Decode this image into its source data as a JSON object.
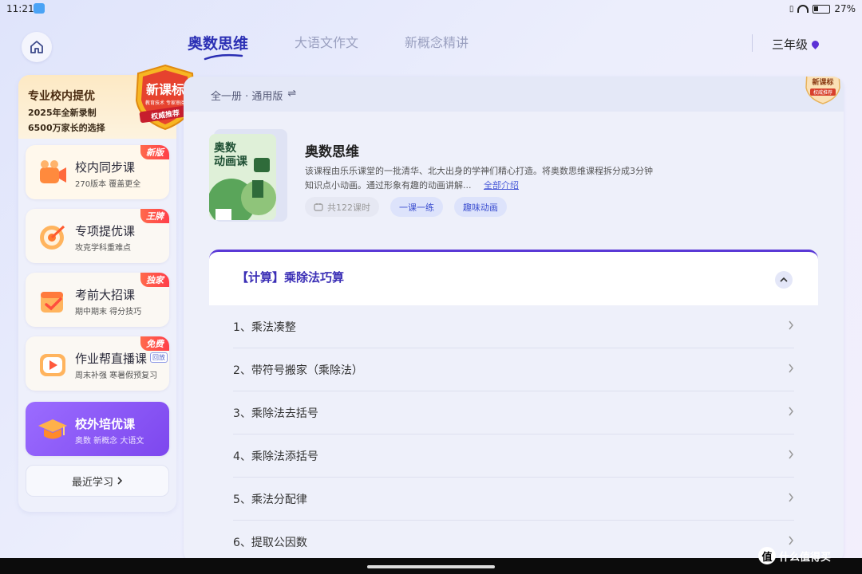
{
  "status": {
    "time": "11:21",
    "battery": "27%"
  },
  "nav": {
    "tabs": [
      {
        "label": "奥数思维",
        "active": true
      },
      {
        "label": "大语文作文",
        "active": false
      },
      {
        "label": "新概念精讲",
        "active": false
      }
    ],
    "grade": "三年级"
  },
  "sidebar": {
    "promo": {
      "headline": "专业校内提优",
      "line1": "2025年全新录制",
      "line2": "6500万家长的选择",
      "badge": "新课标",
      "badge_sub": "教育技术 专家审阅",
      "badge_ribbon": "权威推荐"
    },
    "items": [
      {
        "title": "校内同步课",
        "desc": "270版本 覆盖更全",
        "tag": "新版",
        "icon": "video-camera-icon"
      },
      {
        "title": "专项提优课",
        "desc": "攻克学科重难点",
        "tag": "王牌",
        "icon": "target-icon"
      },
      {
        "title": "考前大招课",
        "desc": "期中期末 得分技巧",
        "tag": "独家",
        "icon": "calendar-check-icon"
      },
      {
        "title": "作业帮直播课",
        "desc": "周末补强 寒暑假预复习",
        "tag": "免费",
        "mini": "回放",
        "icon": "play-icon"
      },
      {
        "title": "校外培优课",
        "desc": "奥数 新概念 大语文",
        "icon": "graduation-cap-icon",
        "active": true
      }
    ],
    "recent": "最近学习"
  },
  "panel": {
    "volume": "全一册 · 通用版",
    "badge": "新课标",
    "badge_ribbon": "权威推荐",
    "course": {
      "cover_text": "奥数\n动画课",
      "title": "奥数思维",
      "desc": "该课程由乐乐课堂的一批清华、北大出身的学神们精心打造。将奥数思维课程拆分成3分钟知识点小动画。通过形象有趣的动画讲解...",
      "more": "全部介绍",
      "pills": [
        "共122课时",
        "一课一练",
        "趣味动画"
      ]
    },
    "chapter": "【计算】乘除法巧算",
    "lessons": [
      "1、乘法凑整",
      "2、带符号搬家（乘除法）",
      "3、乘除法去括号",
      "4、乘除法添括号",
      "5、乘法分配律",
      "6、提取公因数"
    ]
  },
  "watermark": "什么值得买"
}
